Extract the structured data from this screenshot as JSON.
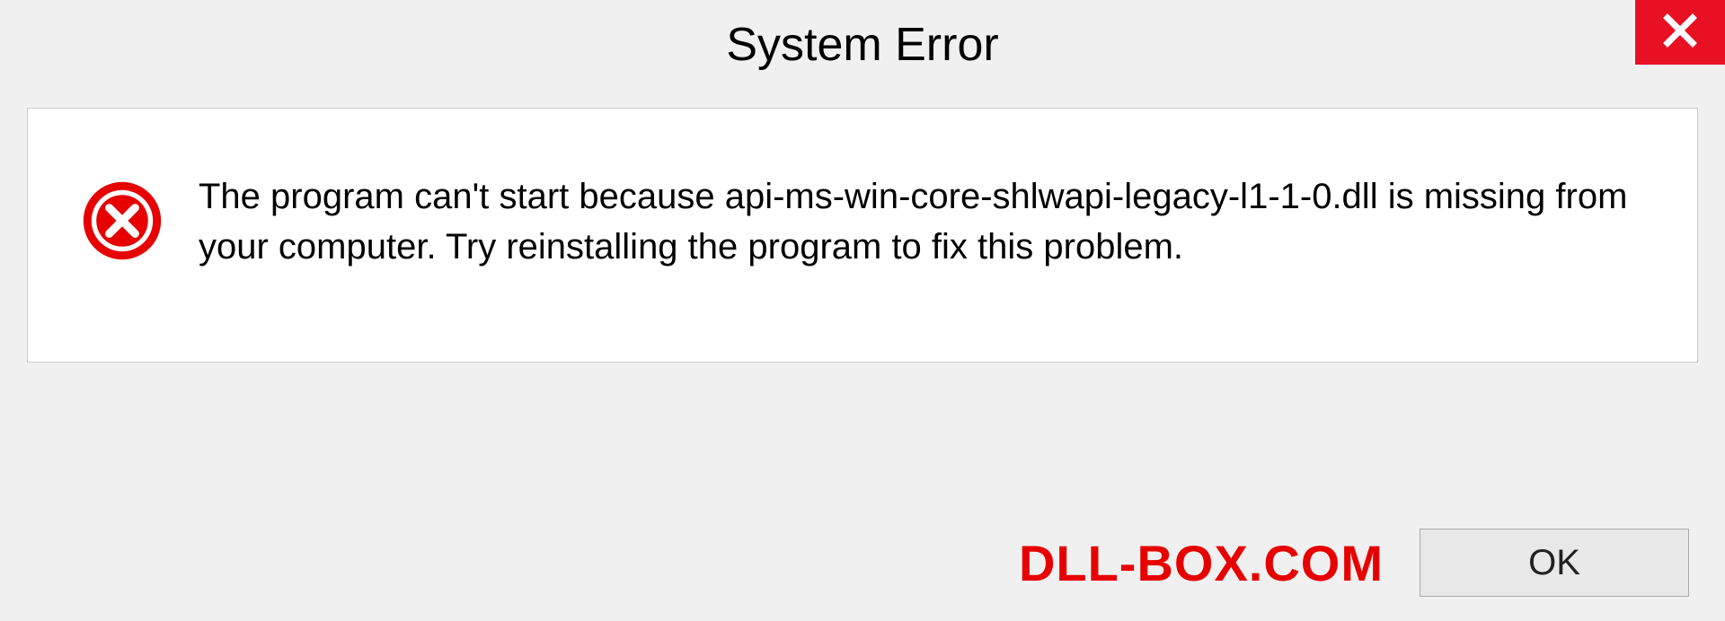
{
  "title": "System Error",
  "message": "The program can't start because api-ms-win-core-shlwapi-legacy-l1-1-0.dll is missing from your computer. Try reinstalling the program to fix this problem.",
  "ok_label": "OK",
  "watermark": "DLL-BOX.COM",
  "colors": {
    "close_bg": "#e81123",
    "error_icon": "#e60000",
    "watermark": "#e60000"
  }
}
